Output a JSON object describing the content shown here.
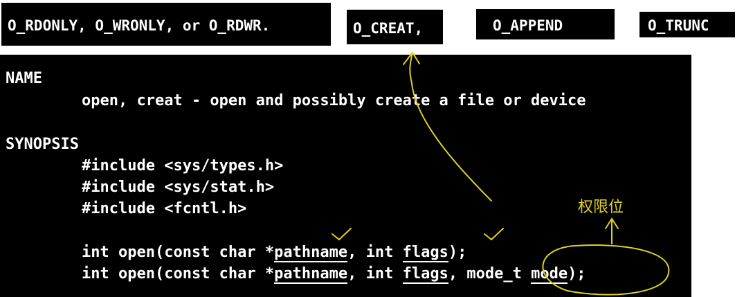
{
  "flags": {
    "access_modes": "O_RDONLY, O_WRONLY, or O_RDWR.",
    "creat": "O_CREAT,",
    "append": "O_APPEND",
    "trunc": "O_TRUNC"
  },
  "man": {
    "name_heading": "NAME",
    "name_desc": "open, creat - open and possibly create a file or device",
    "synopsis_heading": "SYNOPSIS",
    "include1": "#include <sys/types.h>",
    "include2": "#include <sys/stat.h>",
    "include3": "#include <fcntl.h>",
    "proto1": {
      "prefix": "int open(const char *",
      "arg1": "pathname",
      "mid": ", int ",
      "arg2": "flags",
      "suffix": ");"
    },
    "proto2": {
      "prefix": "int open(const char *",
      "arg1": "pathname",
      "mid": ", int ",
      "arg2": "flags",
      "sep": ", ",
      "arg3_type": "mode_t",
      "arg3_space": " ",
      "arg3_name": "mode",
      "suffix": ");"
    }
  },
  "annotation": {
    "permission_label": "权限位",
    "color": "#e0d020"
  }
}
